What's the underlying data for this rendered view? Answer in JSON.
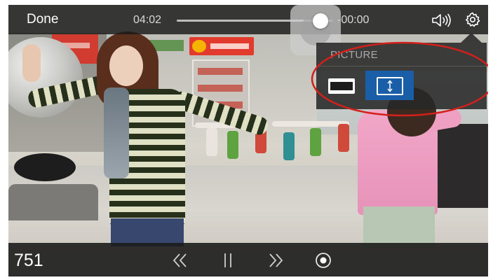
{
  "topbar": {
    "done_label": "Done",
    "time_elapsed": "04:02",
    "time_remaining": "-00:00",
    "progress_fraction": 0.97
  },
  "icons": {
    "volume": "speaker-volume-icon",
    "settings": "gear-icon",
    "rewind": "rewind-icon",
    "pause": "pause-icon",
    "fast_forward": "fast-forward-icon",
    "record": "record-icon",
    "fit": "aspect-fit-icon",
    "fill": "aspect-fill-icon"
  },
  "settings_popup": {
    "title": "PICTURE",
    "selected_mode": "fill",
    "modes": [
      "fit",
      "fill"
    ]
  },
  "bottombar": {
    "frame_counter": "751"
  },
  "colors": {
    "selected_mode": "#1a5ea8",
    "annotation_ring": "#d3201b"
  }
}
